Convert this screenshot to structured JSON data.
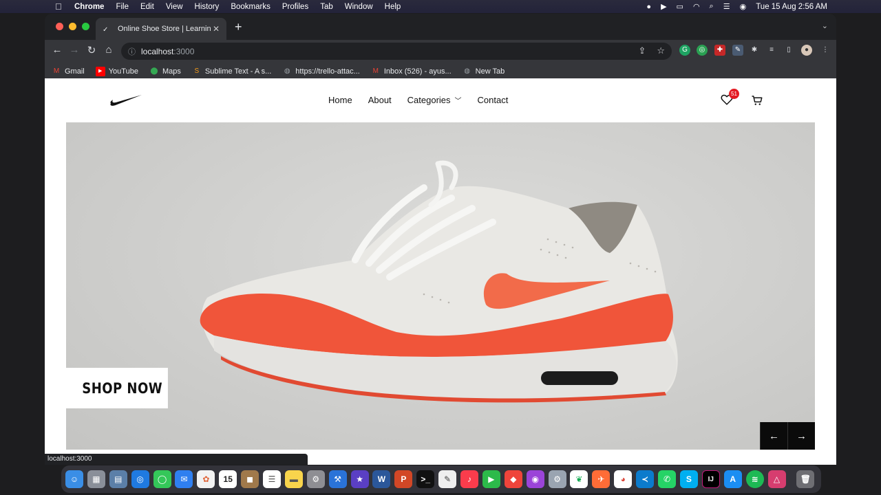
{
  "menubar": {
    "app": "Chrome",
    "items": [
      "File",
      "Edit",
      "View",
      "History",
      "Bookmarks",
      "Profiles",
      "Tab",
      "Window",
      "Help"
    ],
    "clock": "Tue 15 Aug  2:56 AM"
  },
  "browser": {
    "tab_title": "Online Shoe Store | Learning",
    "url_host": "localhost",
    "url_port": ":3000",
    "bookmarks": [
      {
        "label": "Gmail",
        "icon": "gmail-icon",
        "color": "#ea4335"
      },
      {
        "label": "YouTube",
        "icon": "youtube-icon",
        "color": "#ff0000"
      },
      {
        "label": "Maps",
        "icon": "maps-icon",
        "color": "#34a853"
      },
      {
        "label": "Sublime Text - A s...",
        "icon": "sublime-icon",
        "color": "#f59b1b"
      },
      {
        "label": "https://trello-attac...",
        "icon": "globe-icon",
        "color": "#9aa0a6"
      },
      {
        "label": "Inbox (526) - ayus...",
        "icon": "gmail-icon",
        "color": "#ea4335"
      },
      {
        "label": "New Tab",
        "icon": "globe-icon",
        "color": "#9aa0a6"
      }
    ],
    "status_url": "localhost:3000"
  },
  "site": {
    "nav": {
      "home": "Home",
      "about": "About",
      "categories": "Categories",
      "contact": "Contact"
    },
    "wishlist_count": "51",
    "hero": {
      "cta": "SHOP NOW",
      "prev": "←",
      "next": "→"
    },
    "colors": {
      "badge": "#e31b23",
      "shoe_red": "#f0553a",
      "hero_bg": "#d1d1cf"
    }
  },
  "dock": {
    "apps": [
      "finder-icon",
      "launchpad-icon",
      "preview-icon",
      "safari-icon",
      "messages-icon",
      "mail-icon",
      "photos-icon",
      "calendar-icon",
      "contacts-icon",
      "reminders-icon",
      "notes-icon",
      "settings-icon",
      "xcode-icon",
      "imovie-icon",
      "word-icon",
      "powerpoint-icon",
      "terminal-icon",
      "textedit-icon",
      "music-icon",
      "facetime-icon",
      "anydesk-icon",
      "podcasts-icon",
      "system-prefs-icon",
      "mongodb-icon",
      "postman-icon",
      "chrome-icon",
      "vscode-icon",
      "whatsapp-icon",
      "skype-icon",
      "intellij-icon",
      "appstore-icon",
      "spotify-icon",
      "affinity-icon",
      "trash-icon"
    ],
    "calendar_day": "15"
  }
}
